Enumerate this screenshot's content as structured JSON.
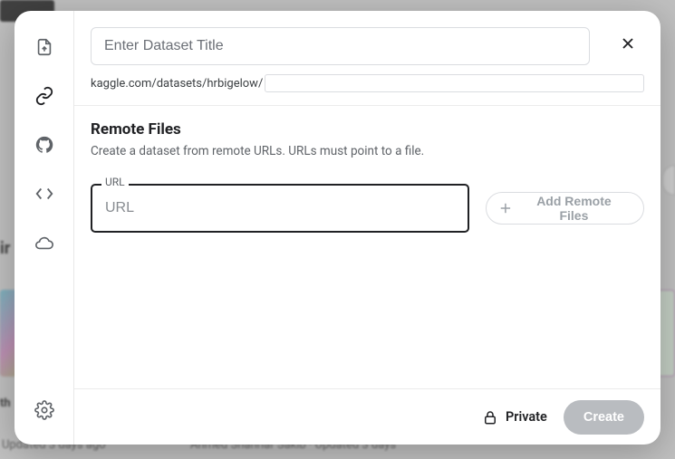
{
  "sidebar": {
    "items": [
      {
        "name": "upload-file-icon"
      },
      {
        "name": "link-icon"
      },
      {
        "name": "github-icon"
      },
      {
        "name": "code-icon"
      },
      {
        "name": "cloud-icon"
      }
    ],
    "settings_name": "gear-icon"
  },
  "header": {
    "title_placeholder": "Enter Dataset Title",
    "title_value": "",
    "slug_prefix": "kaggle.com/datasets/hrbigelow/",
    "slug_value": ""
  },
  "section": {
    "heading": "Remote Files",
    "description": "Create a dataset from remote URLs. URLs must point to a file.",
    "url_label": "URL",
    "url_placeholder": "URL",
    "url_value": "",
    "add_button_label": "Add Remote Files"
  },
  "footer": {
    "privacy_label": "Private",
    "create_label": "Create"
  },
  "background": {
    "muted_text_1": "Updated 3 days ago",
    "muted_text_2": "Ahmed Shahriar Sakib · Updated 3 days"
  }
}
